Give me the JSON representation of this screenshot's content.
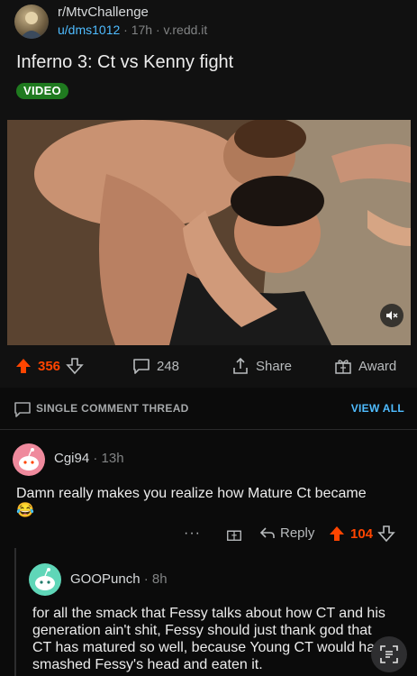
{
  "post": {
    "subreddit": "r/MtvChallenge",
    "author": "u/dms1012",
    "age": "17h",
    "domain": "v.redd.it",
    "title": "Inferno 3: Ct vs Kenny fight",
    "badge": "VIDEO"
  },
  "actions": {
    "upvotes": "356",
    "comments": "248",
    "share": "Share",
    "award": "Award"
  },
  "thread": {
    "label": "SINGLE COMMENT THREAD",
    "view_all": "VIEW ALL"
  },
  "comments": [
    {
      "user": "Cgi94",
      "age": "13h",
      "text": "Damn really makes you realize how Mature Ct became",
      "emoji": "😂",
      "more": "···",
      "reply": "Reply",
      "votes": "104"
    },
    {
      "user": "GOOPunch",
      "age": "8h",
      "text": "for all the smack that Fessy talks about how CT and his generation ain't shit, Fessy should just thank god that CT has matured so well, because Young CT would have smashed Fessy's head and eaten it."
    }
  ],
  "colors": {
    "upvote": "#ff4500",
    "link": "#4fbcff",
    "badge": "#1f7a1f"
  }
}
